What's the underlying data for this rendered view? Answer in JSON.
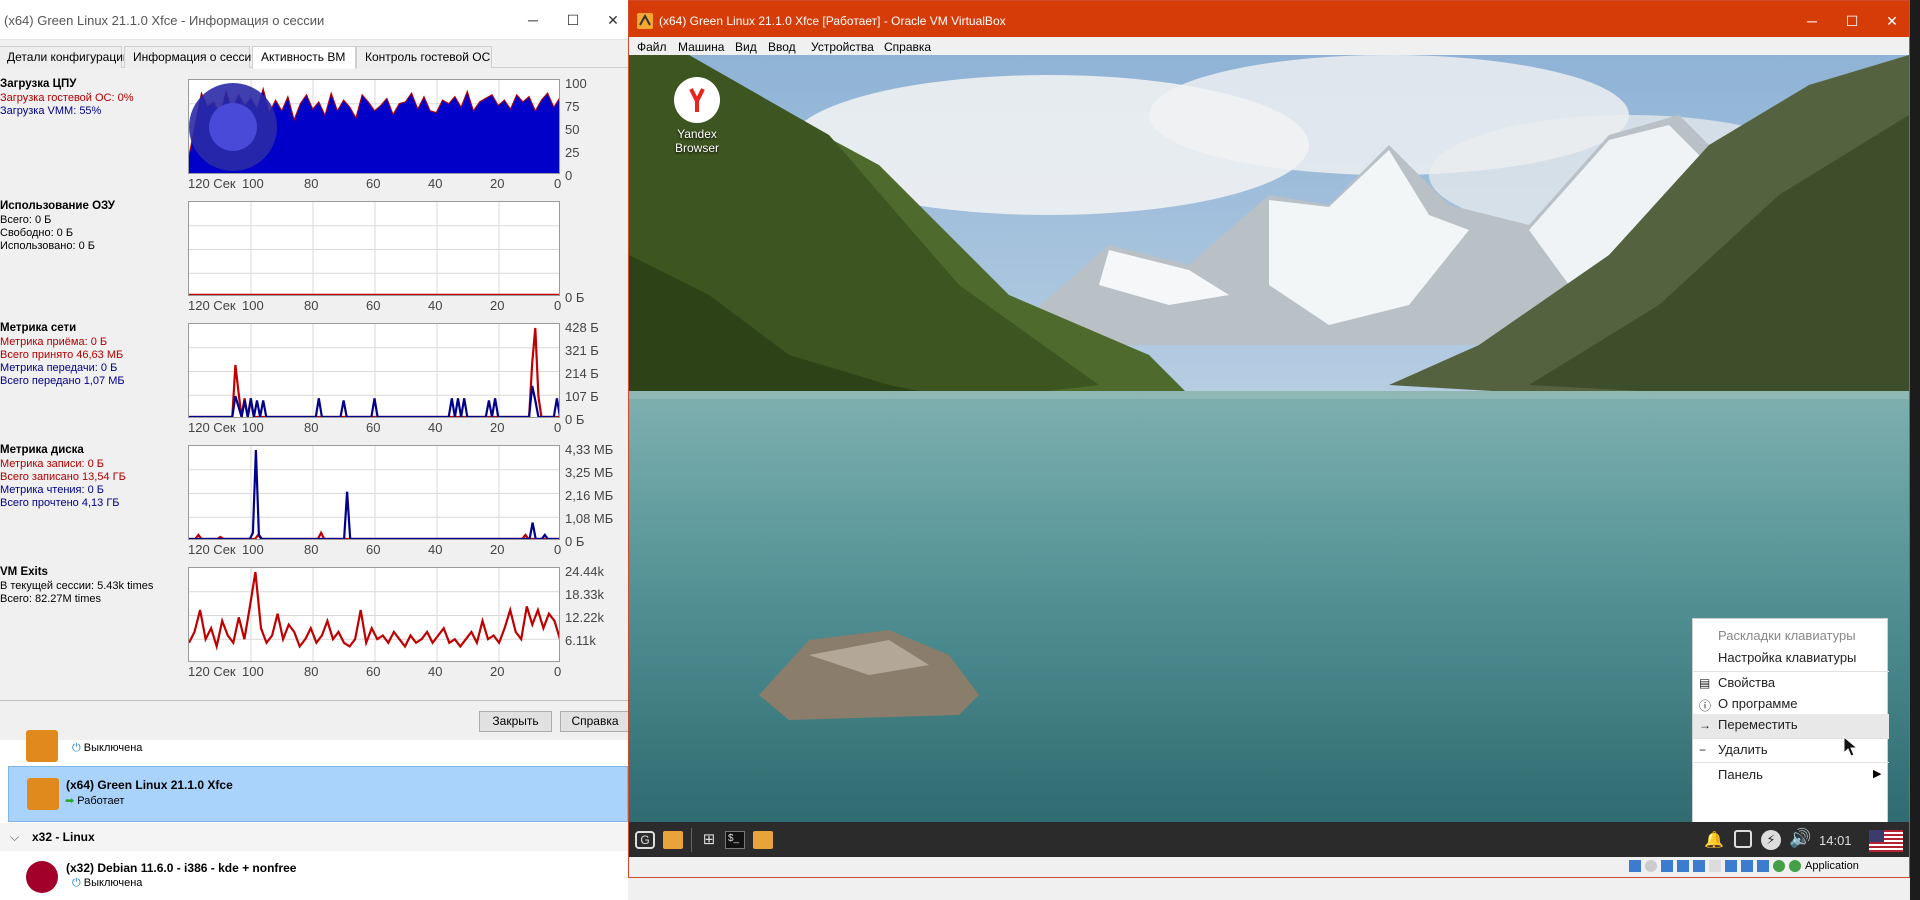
{
  "session_window": {
    "title": "(x64) Green Linux 21.1.0 Xfce - Информация о сессии",
    "controls": {
      "minimize": "─",
      "maximize": "☐",
      "close": "✕"
    },
    "tabs": [
      "Детали конфигурации",
      "Информация о сессии",
      "Активность ВМ",
      "Контроль гостевой ОС"
    ],
    "active_tab": "Активность ВМ",
    "x_ticks": [
      "120 Сек",
      "100",
      "80",
      "60",
      "40",
      "20",
      "0"
    ],
    "cpu": {
      "title": "Загрузка ЦПУ",
      "lines": [
        "Загрузка гостевой ОС: 0%",
        "Загрузка VMM: 55%"
      ],
      "y_ticks": [
        "100",
        "75",
        "50",
        "25",
        "0"
      ]
    },
    "ram": {
      "title": "Использование ОЗУ",
      "lines": [
        "Всего: 0 Б",
        "Свободно: 0 Б",
        "Использовано: 0 Б"
      ],
      "y_ticks": [
        "0 Б"
      ]
    },
    "network": {
      "title": "Метрика сети",
      "lines": [
        "Метрика приёма: 0 Б",
        "Всего принято 46,63 МБ",
        "Метрика передачи: 0 Б",
        "Всего передано 1,07 МБ"
      ],
      "y_ticks": [
        "428 Б",
        "321 Б",
        "214 Б",
        "107 Б",
        "0 Б"
      ]
    },
    "disk": {
      "title": "Метрика диска",
      "lines": [
        "Метрика записи: 0 Б",
        "Всего записано 13,54 ГБ",
        "Метрика чтения: 0 Б",
        "Всего прочтено 4,13 ГБ"
      ],
      "y_ticks": [
        "4,33 МБ",
        "3,25 МБ",
        "2,16 МБ",
        "1,08 МБ",
        "0 Б"
      ]
    },
    "vmexits": {
      "title": "VM Exits",
      "lines": [
        "В текущей сессии: 5.43k times",
        "Всего: 82.27M times"
      ],
      "y_ticks": [
        "24.44k",
        "18.33k",
        "12.22k",
        "6.11k"
      ]
    },
    "close_button": "Закрыть",
    "help_button": "Справка"
  },
  "vm_list": {
    "items": [
      {
        "name": "",
        "state": "Выключена"
      },
      {
        "name": "(x64) Green Linux 21.1.0 Xfce",
        "state": "Работает"
      },
      {
        "name": "(x32) Debian 11.6.0 - i386 - kde + nonfree",
        "state": "Выключена"
      }
    ],
    "group_label": "x32 - Linux"
  },
  "vbox_window": {
    "title": "(x64) Green Linux 21.1.0 Xfce [Работает] - Oracle VM VirtualBox",
    "menu": [
      "Файл",
      "Машина",
      "Вид",
      "Ввод",
      "Устройства",
      "Справка"
    ],
    "desktop_icon_label": "Yandex Browser",
    "context_menu": {
      "items": [
        "Раскладки клавиатуры",
        "Настройка клавиатуры",
        "Свойства",
        "О программе",
        "Переместить",
        "Удалить",
        "Панель"
      ],
      "disabled_item": "Раскладки клавиатуры",
      "hovered_item": "Переместить"
    },
    "panel": {
      "clock": "14:01"
    },
    "status_bar": {
      "host_key_label": "Application"
    }
  },
  "colors": {
    "red_series": "#c00000",
    "blue_series": "#00008b",
    "title_bar": "#d53c08",
    "selected_row": "#a9d3fb"
  },
  "chart_data": [
    {
      "type": "area",
      "title": "Загрузка ЦПУ",
      "x_range": [
        120,
        0
      ],
      "ylim": [
        0,
        100
      ],
      "grid": true,
      "series": [
        {
          "name": "Загрузка VMM",
          "values": [
            20,
            55,
            90,
            75,
            80,
            65,
            92,
            70,
            88,
            76,
            84,
            72,
            95,
            68,
            82,
            70,
            86,
            60,
            78,
            88,
            72,
            80,
            65,
            90,
            70,
            82,
            74,
            62,
            88,
            80,
            70,
            76,
            84,
            66,
            78,
            80,
            90,
            72,
            86,
            70,
            68,
            82,
            78,
            86,
            74,
            92,
            70,
            80,
            84,
            88,
            76,
            82,
            72,
            88,
            80,
            86,
            70,
            82,
            90,
            74,
            85
          ]
        }
      ]
    },
    {
      "type": "line",
      "title": "Использование ОЗУ",
      "x_range": [
        120,
        0
      ],
      "grid": true,
      "series": [
        {
          "values": [
            0,
            0,
            0,
            0,
            0,
            0,
            0,
            0,
            0,
            0,
            0
          ]
        }
      ]
    },
    {
      "type": "line",
      "title": "Метрика сети",
      "x_range": [
        120,
        0
      ],
      "ylim": [
        0,
        428
      ],
      "grid": true,
      "series": [
        {
          "name": "Метрика приёма",
          "values": [
            0,
            0,
            0,
            0,
            0,
            0,
            0,
            0,
            0,
            0,
            0,
            0,
            0,
            0,
            0,
            250,
            120,
            0,
            90,
            0,
            80,
            0,
            0,
            0,
            0,
            0,
            0,
            0,
            0,
            0,
            0,
            0,
            0,
            0,
            0,
            0,
            0,
            0,
            0,
            0,
            0,
            0,
            0,
            0,
            0,
            0,
            0,
            0,
            0,
            0,
            0,
            0,
            0,
            0,
            0,
            0,
            0,
            0,
            0,
            0,
            0,
            0,
            0,
            0,
            0,
            0,
            0,
            0,
            0,
            0,
            0,
            0,
            0,
            0,
            0,
            0,
            0,
            0,
            0,
            0,
            0,
            0,
            0,
            0,
            0,
            0,
            0,
            0,
            0,
            0,
            0,
            0,
            0,
            0,
            0,
            0,
            0,
            0,
            0,
            0,
            0,
            0,
            0,
            0,
            0,
            0,
            0,
            0,
            0,
            0,
            0,
            260,
            428,
            100,
            0,
            0,
            0,
            0,
            0,
            0,
            0
          ]
        },
        {
          "name": "Метрика передачи",
          "values": [
            0,
            0,
            0,
            0,
            0,
            0,
            0,
            0,
            0,
            0,
            0,
            0,
            0,
            0,
            0,
            100,
            50,
            0,
            80,
            0,
            90,
            0,
            80,
            0,
            80,
            0,
            0,
            0,
            0,
            0,
            0,
            0,
            0,
            0,
            0,
            0,
            0,
            0,
            0,
            0,
            0,
            0,
            90,
            0,
            0,
            0,
            0,
            0,
            0,
            0,
            80,
            0,
            0,
            0,
            0,
            0,
            0,
            0,
            0,
            0,
            90,
            0,
            0,
            0,
            0,
            0,
            0,
            0,
            0,
            0,
            0,
            0,
            0,
            0,
            0,
            0,
            0,
            0,
            0,
            0,
            0,
            0,
            0,
            0,
            0,
            90,
            0,
            90,
            0,
            90,
            0,
            0,
            0,
            0,
            0,
            0,
            0,
            80,
            0,
            90,
            0,
            0,
            0,
            0,
            0,
            0,
            0,
            0,
            0,
            0,
            0,
            150,
            80,
            0,
            0,
            0,
            0,
            0,
            0,
            90,
            0
          ]
        }
      ]
    },
    {
      "type": "line",
      "title": "Метрика диска",
      "x_range": [
        120,
        0
      ],
      "ylim": [
        0,
        4.33
      ],
      "grid": true,
      "series": [
        {
          "name": "Метрика записи",
          "values": [
            0,
            0,
            0,
            0.2,
            0,
            0,
            0,
            0,
            0,
            0,
            0.1,
            0,
            0,
            0,
            0,
            0,
            0,
            0,
            0,
            0,
            0,
            0,
            0.2,
            0,
            0,
            0,
            0,
            0,
            0,
            0,
            0,
            0,
            0,
            0,
            0,
            0,
            0,
            0,
            0,
            0,
            0,
            0,
            0.3,
            0,
            0,
            0,
            0,
            0,
            0,
            0,
            0,
            0,
            0,
            0,
            0,
            0,
            0,
            0,
            0,
            0,
            0,
            0,
            0,
            0,
            0,
            0,
            0,
            0,
            0,
            0,
            0,
            0,
            0,
            0,
            0,
            0,
            0,
            0,
            0,
            0,
            0,
            0,
            0,
            0,
            0,
            0,
            0,
            0,
            0,
            0,
            0,
            0,
            0,
            0,
            0,
            0,
            0,
            0,
            0,
            0,
            0,
            0,
            0,
            0,
            0,
            0,
            0,
            0.2,
            0,
            0,
            0,
            0,
            0,
            0,
            0,
            0,
            0,
            0,
            0
          ]
        },
        {
          "name": "Метрика чтения",
          "values": [
            0,
            0,
            0,
            0,
            0,
            0,
            0,
            0,
            0,
            0,
            0,
            0,
            0,
            0,
            0,
            0,
            0,
            0,
            0,
            0,
            0,
            0.3,
            4.33,
            0.2,
            0,
            0,
            0,
            0,
            0,
            0,
            0,
            0,
            0,
            0,
            0,
            0,
            0,
            0,
            0,
            0,
            0,
            0,
            0,
            0,
            0,
            0,
            0,
            0,
            0,
            0,
            0,
            0,
            2.3,
            0,
            0,
            0,
            0,
            0,
            0,
            0,
            0,
            0,
            0,
            0,
            0,
            0,
            0,
            0,
            0,
            0,
            0,
            0,
            0,
            0,
            0,
            0,
            0,
            0,
            0,
            0,
            0,
            0,
            0,
            0,
            0,
            0,
            0,
            0,
            0,
            0,
            0,
            0,
            0,
            0,
            0,
            0,
            0,
            0,
            0,
            0,
            0,
            0,
            0,
            0,
            0,
            0,
            0,
            0,
            0,
            0,
            0,
            0,
            0,
            0.8,
            0,
            0,
            0,
            0.2,
            0,
            0,
            0,
            0,
            0
          ]
        }
      ]
    },
    {
      "type": "line",
      "title": "VM Exits",
      "x_range": [
        120,
        0
      ],
      "ylim": [
        0,
        24440
      ],
      "grid": true,
      "series": [
        {
          "name": "В текущей сессии",
          "values": [
            5000,
            8000,
            14000,
            6000,
            9000,
            4000,
            11000,
            7000,
            5000,
            12000,
            6000,
            15000,
            24440,
            9000,
            5000,
            7000,
            13000,
            6000,
            10000,
            8000,
            4000,
            6000,
            9000,
            5000,
            7000,
            11000,
            6000,
            8000,
            5000,
            4000,
            6000,
            14000,
            5000,
            9000,
            6000,
            7000,
            5000,
            8000,
            6000,
            4000,
            7000,
            5000,
            6000,
            8000,
            5000,
            7000,
            9000,
            5000,
            6000,
            4000,
            6000,
            8000,
            5000,
            11000,
            6000,
            7000,
            5000,
            9000,
            14000,
            8000,
            6000,
            15000,
            10000,
            14000,
            9000,
            13000,
            11000,
            6000
          ]
        }
      ]
    }
  ]
}
